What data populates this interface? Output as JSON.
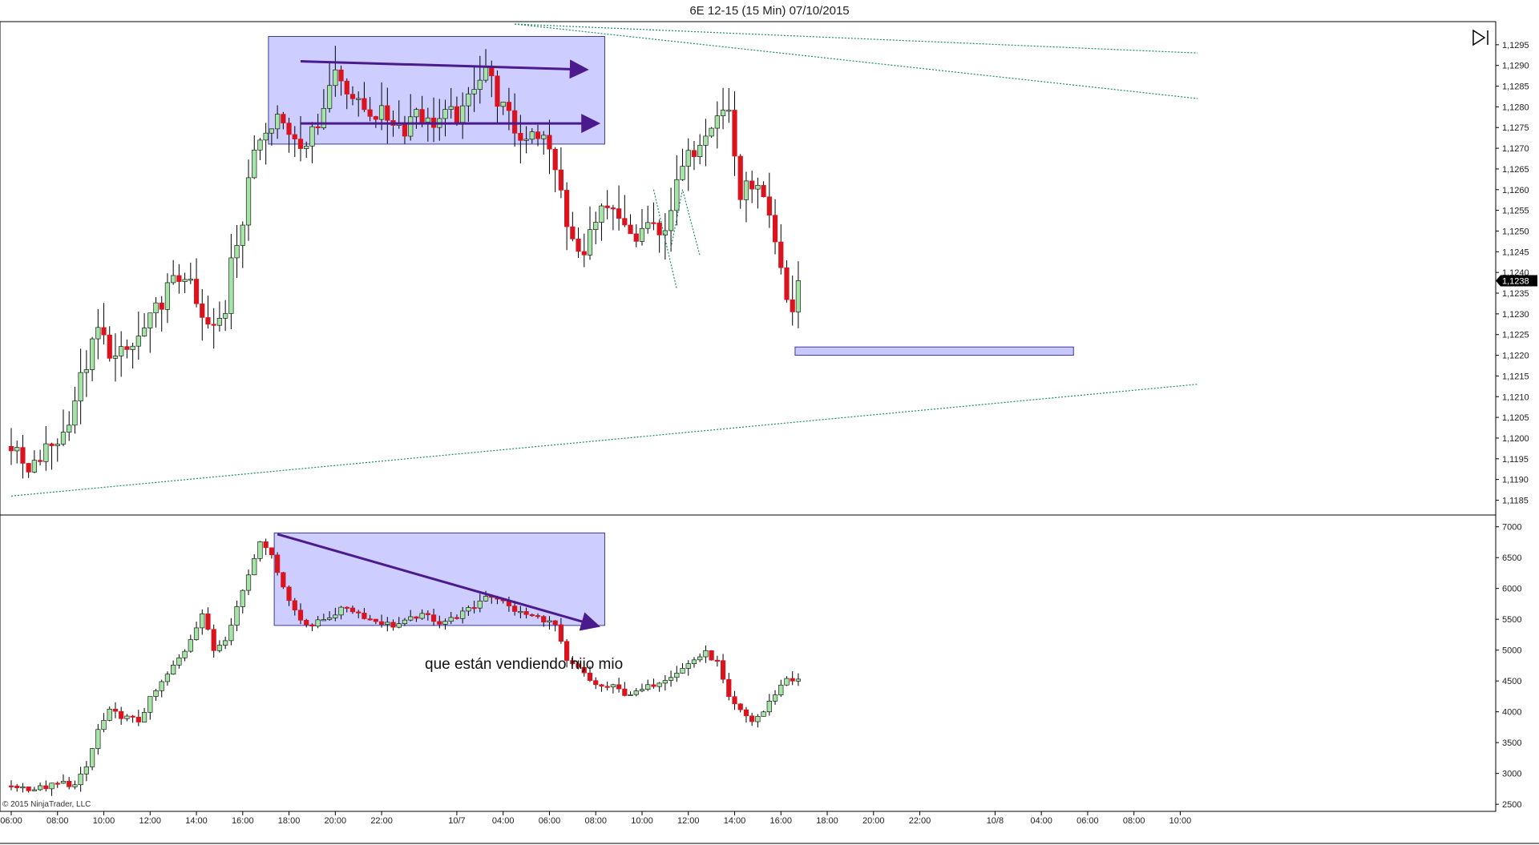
{
  "title": "6E 12-15 (15 Min)  07/10/2015",
  "copyright": "© 2015 NinjaTrader, LLC",
  "note": "que están vendiendo hijo mio",
  "last_price_label": "1,1238",
  "icons": {
    "forward": "forward-to-end-icon"
  },
  "colors": {
    "up": "#a6e3a6",
    "down": "#d9141f",
    "box_fill": "#c8c8ff",
    "box_stroke": "#3a3a9a",
    "arrow": "#4b1a8c",
    "trendline": "#1e8a6a"
  },
  "chart_data": [
    {
      "type": "candlestick",
      "name": "price",
      "ylim": [
        1.1182,
        1.13
      ],
      "y_ticks": [
        "1,1185",
        "1,1190",
        "1,1195",
        "1,1200",
        "1,1205",
        "1,1210",
        "1,1215",
        "1,1220",
        "1,1225",
        "1,1230",
        "1,1235",
        "1,1240",
        "1,1245",
        "1,1250",
        "1,1255",
        "1,1260",
        "1,1265",
        "1,1270",
        "1,1275",
        "1,1280",
        "1,1285",
        "1,1290",
        "1,1295"
      ],
      "y_tick_values": [
        1.1185,
        1.119,
        1.1195,
        1.12,
        1.1205,
        1.121,
        1.1215,
        1.122,
        1.1225,
        1.123,
        1.1235,
        1.124,
        1.1245,
        1.125,
        1.1255,
        1.126,
        1.1265,
        1.127,
        1.1275,
        1.128,
        1.1285,
        1.129,
        1.1295
      ],
      "key_path": [
        [
          0,
          1.1198
        ],
        [
          3,
          1.1191
        ],
        [
          6,
          1.1197
        ],
        [
          9,
          1.1201
        ],
        [
          12,
          1.1214
        ],
        [
          15,
          1.1226
        ],
        [
          18,
          1.1219
        ],
        [
          21,
          1.1222
        ],
        [
          24,
          1.1228
        ],
        [
          27,
          1.1236
        ],
        [
          30,
          1.124
        ],
        [
          33,
          1.1228
        ],
        [
          35,
          1.1226
        ],
        [
          37,
          1.1231
        ],
        [
          38,
          1.1245
        ],
        [
          40,
          1.1252
        ],
        [
          42,
          1.127
        ],
        [
          44,
          1.1276
        ],
        [
          46,
          1.1278
        ],
        [
          48,
          1.1274
        ],
        [
          50,
          1.1272
        ],
        [
          52,
          1.1273
        ],
        [
          54,
          1.1281
        ],
        [
          56,
          1.1289
        ],
        [
          58,
          1.1285
        ],
        [
          60,
          1.128
        ],
        [
          62,
          1.1279
        ],
        [
          64,
          1.1278
        ],
        [
          66,
          1.1277
        ],
        [
          68,
          1.1275
        ],
        [
          70,
          1.128
        ],
        [
          72,
          1.1276
        ],
        [
          74,
          1.1277
        ],
        [
          76,
          1.1278
        ],
        [
          78,
          1.1278
        ],
        [
          80,
          1.1286
        ],
        [
          82,
          1.129
        ],
        [
          84,
          1.1282
        ],
        [
          86,
          1.1277
        ],
        [
          88,
          1.1272
        ],
        [
          90,
          1.1275
        ],
        [
          92,
          1.1272
        ],
        [
          94,
          1.1266
        ],
        [
          96,
          1.1251
        ],
        [
          98,
          1.1244
        ],
        [
          100,
          1.1249
        ],
        [
          102,
          1.1254
        ],
        [
          104,
          1.1254
        ],
        [
          106,
          1.125
        ],
        [
          108,
          1.1248
        ],
        [
          110,
          1.1252
        ],
        [
          112,
          1.1248
        ],
        [
          114,
          1.1256
        ],
        [
          116,
          1.1265
        ],
        [
          118,
          1.127
        ],
        [
          120,
          1.1275
        ],
        [
          122,
          1.1279
        ],
        [
          124,
          1.1279
        ],
        [
          126,
          1.1258
        ],
        [
          128,
          1.1262
        ],
        [
          130,
          1.1257
        ],
        [
          132,
          1.1246
        ],
        [
          134,
          1.1233
        ],
        [
          135,
          1.1231
        ],
        [
          136,
          1.1238
        ]
      ]
    },
    {
      "type": "candlestick",
      "name": "volume-lower-panel",
      "ylim": [
        2450,
        7100
      ],
      "y_ticks": [
        "7000",
        "6500",
        "6000",
        "5500",
        "5000",
        "4500",
        "4000",
        "3500",
        "3000",
        "2500"
      ],
      "y_tick_values": [
        7000,
        6500,
        6000,
        5500,
        5000,
        4500,
        4000,
        3500,
        3000,
        2500
      ],
      "key_path": [
        [
          0,
          2800
        ],
        [
          4,
          2750
        ],
        [
          6,
          2780
        ],
        [
          9,
          2850
        ],
        [
          11,
          2800
        ],
        [
          13,
          3100
        ],
        [
          15,
          3700
        ],
        [
          17,
          4000
        ],
        [
          20,
          3900
        ],
        [
          22,
          3850
        ],
        [
          24,
          4200
        ],
        [
          27,
          4600
        ],
        [
          30,
          5000
        ],
        [
          33,
          5600
        ],
        [
          35,
          5000
        ],
        [
          37,
          5200
        ],
        [
          39,
          5700
        ],
        [
          42,
          6500
        ],
        [
          43,
          6800
        ],
        [
          44,
          6700
        ],
        [
          46,
          6300
        ],
        [
          48,
          5800
        ],
        [
          50,
          5500
        ],
        [
          52,
          5400
        ],
        [
          54,
          5500
        ],
        [
          56,
          5600
        ],
        [
          58,
          5700
        ],
        [
          60,
          5600
        ],
        [
          62,
          5500
        ],
        [
          64,
          5450
        ],
        [
          66,
          5400
        ],
        [
          68,
          5450
        ],
        [
          70,
          5550
        ],
        [
          72,
          5550
        ],
        [
          74,
          5450
        ],
        [
          76,
          5500
        ],
        [
          78,
          5600
        ],
        [
          80,
          5700
        ],
        [
          82,
          5900
        ],
        [
          84,
          5850
        ],
        [
          86,
          5700
        ],
        [
          88,
          5600
        ],
        [
          90,
          5550
        ],
        [
          92,
          5500
        ],
        [
          94,
          5400
        ],
        [
          96,
          4800
        ],
        [
          98,
          4700
        ],
        [
          100,
          4500
        ],
        [
          102,
          4400
        ],
        [
          104,
          4400
        ],
        [
          106,
          4300
        ],
        [
          108,
          4300
        ],
        [
          110,
          4400
        ],
        [
          112,
          4500
        ],
        [
          114,
          4600
        ],
        [
          116,
          4700
        ],
        [
          118,
          4850
        ],
        [
          120,
          4950
        ],
        [
          122,
          4800
        ],
        [
          124,
          4200
        ],
        [
          126,
          4000
        ],
        [
          128,
          3850
        ],
        [
          130,
          4000
        ],
        [
          132,
          4300
        ],
        [
          134,
          4550
        ],
        [
          136,
          4500
        ]
      ]
    }
  ],
  "x_axis": {
    "labels": [
      "06:00",
      "08:00",
      "10:00",
      "12:00",
      "14:00",
      "16:00",
      "18:00",
      "20:00",
      "22:00",
      "10/7",
      "04:00",
      "06:00",
      "08:00",
      "10:00",
      "12:00",
      "14:00",
      "16:00",
      "18:00",
      "20:00",
      "22:00",
      "10/8",
      "04:00",
      "06:00",
      "08:00",
      "10:00"
    ],
    "label_bars": [
      0,
      8,
      16,
      24,
      32,
      40,
      48,
      56,
      64,
      77,
      85,
      93,
      101,
      109,
      117,
      125,
      133,
      141,
      149,
      157,
      170,
      178,
      186,
      194,
      202
    ]
  },
  "annotations": {
    "upper_box_bars": [
      45,
      102
    ],
    "upper_box_prices": [
      1.1271,
      1.1297
    ],
    "upper_arrow_top": [
      [
        50,
        1.1291
      ],
      [
        99,
        1.1289
      ]
    ],
    "upper_arrow_mid": [
      [
        50,
        1.1276
      ],
      [
        101,
        1.1276
      ]
    ],
    "target_box_bars": [
      136,
      183
    ],
    "target_box_prices": [
      1.122,
      1.1222
    ],
    "lower_box_bars": [
      46,
      102
    ],
    "lower_box_values": [
      5400,
      6900
    ],
    "lower_arrow": [
      [
        46,
        6880
      ],
      [
        101,
        5400
      ]
    ],
    "trend_upper": [
      [
        87,
        1.13
      ],
      [
        205,
        1.1282
      ]
    ],
    "trend_upper2": [
      [
        87,
        1.13
      ],
      [
        205,
        1.1293
      ]
    ],
    "trend_lower": [
      [
        0,
        1.1186
      ],
      [
        205,
        1.1213
      ]
    ],
    "dotted_pattern": [
      [
        111,
        1.126
      ],
      [
        115,
        1.1236
      ]
    ],
    "dotted_pattern2": [
      [
        114,
        1.1246
      ],
      [
        116,
        1.126
      ],
      [
        119,
        1.1244
      ]
    ]
  }
}
